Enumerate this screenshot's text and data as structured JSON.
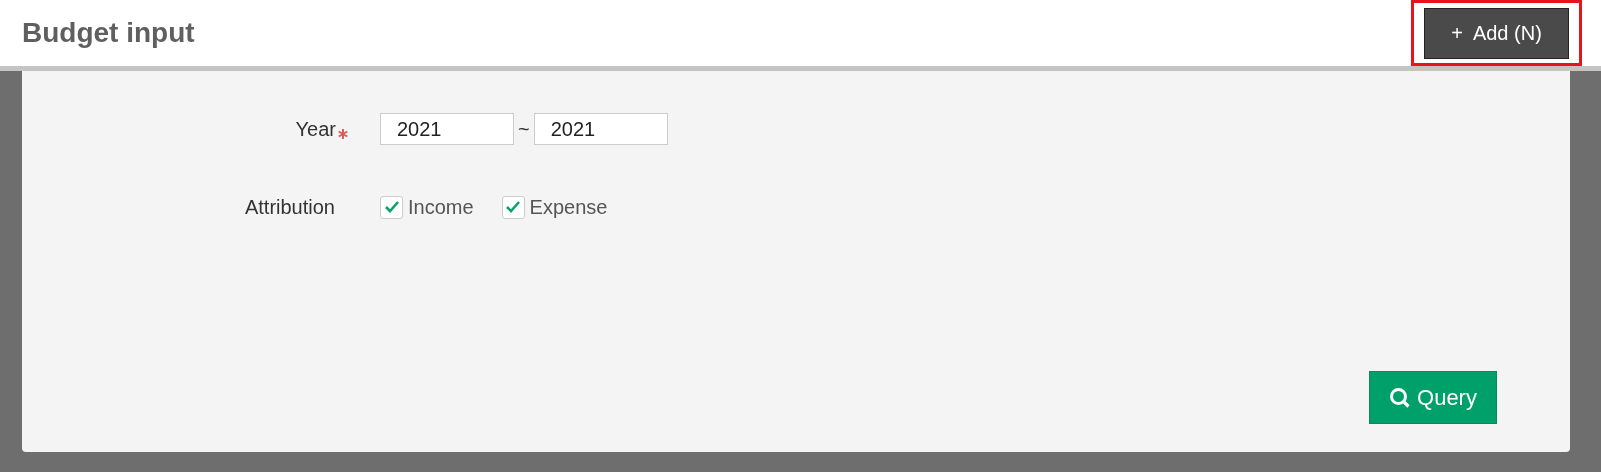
{
  "header": {
    "title": "Budget input",
    "add_button": {
      "icon": "+",
      "label": "Add (N)",
      "highlighted": true
    }
  },
  "form": {
    "year": {
      "label": "Year",
      "required": true,
      "from": "2021",
      "separator": "~",
      "to": "2021"
    },
    "attribution": {
      "label": "Attribution",
      "options": [
        {
          "label": "Income",
          "checked": true
        },
        {
          "label": "Expense",
          "checked": true
        }
      ]
    }
  },
  "query_button": {
    "label": "Query"
  }
}
